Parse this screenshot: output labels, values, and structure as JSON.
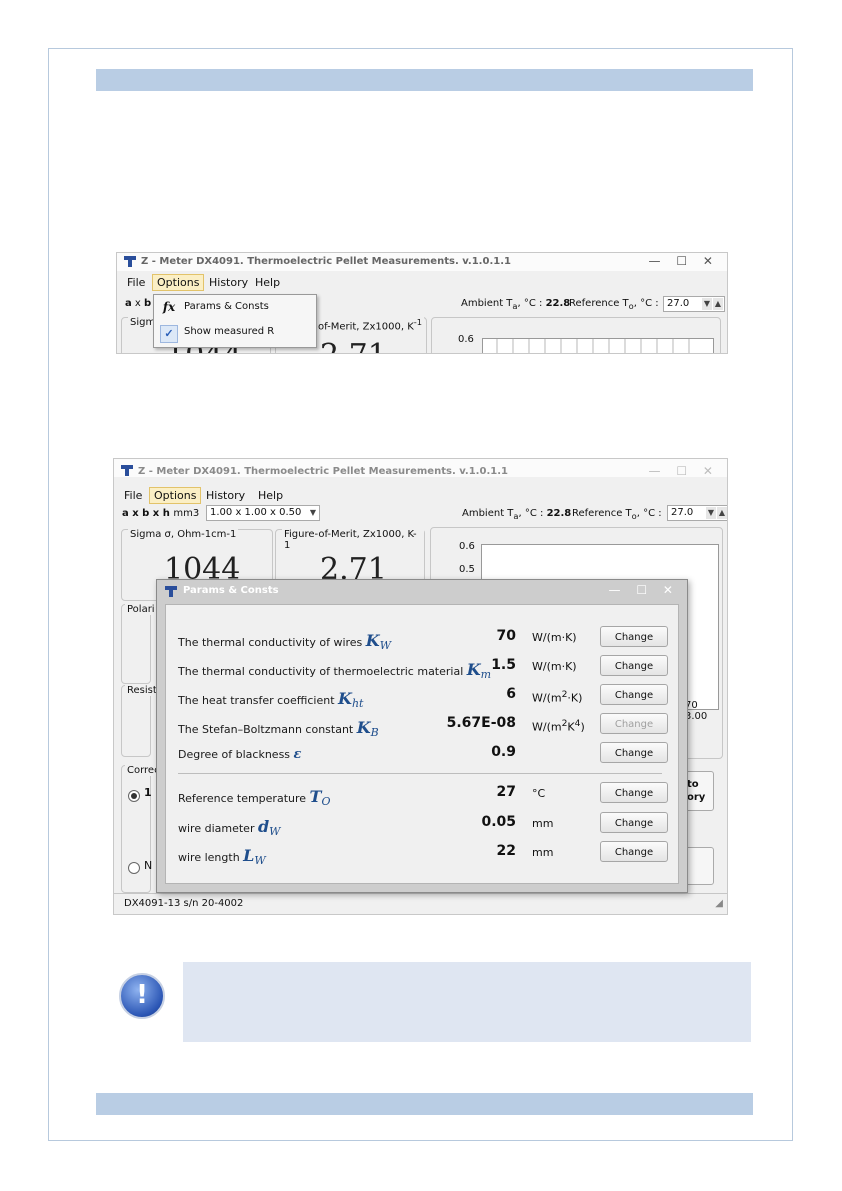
{
  "app": {
    "title": "Z - Meter DX4091. Thermoelectric Pellet Measurements. v.1.0.1.1",
    "window_controls": [
      "—",
      "☐",
      "✕"
    ],
    "menu": [
      "File",
      "Options",
      "History",
      "Help"
    ],
    "size_label": "a x b x h",
    "size_unit": "mm3",
    "size_value": "1.00 x 1.00 x 0.50",
    "ambient_label": "Ambient T",
    "ambient_sub": "a",
    "ambient_unit": ", °C :",
    "ambient_value": "22.8",
    "reference_label": "Reference T",
    "reference_sub": "o",
    "reference_unit": ", °C :",
    "reference_value": "27.0",
    "sigma_label": "Sigma σ, Ohm-1cm-1",
    "sigma_value": "1044",
    "zfom_label": "Figure-of-Merit, Zx1000, K-1",
    "zfom_value": "2.71",
    "chart_ticks": [
      "0.6",
      "0.5"
    ],
    "chart_xtick": "70 3.00",
    "group_labels": [
      "Polari",
      "Resist",
      "Correc"
    ],
    "radio_1": "1",
    "radio_n": "N",
    "side_button": "to ory",
    "status": "DX4091-13 s/n 20-4002"
  },
  "options_menu": {
    "items": [
      {
        "icon": "fx",
        "label": "Params & Consts"
      },
      {
        "icon": "✓",
        "label": "Show measured R"
      }
    ]
  },
  "dialog": {
    "title": "Params & Consts",
    "rows": [
      {
        "label": "The thermal conductivity of wires",
        "sym": "K",
        "sub": "W",
        "value": "70",
        "unit": "W/(m·K)",
        "button": "Change",
        "enabled": true
      },
      {
        "label": "The thermal conductivity of thermoelectric material",
        "sym": "K",
        "sub": "m",
        "value": "1.5",
        "unit": "W/(m·K)",
        "button": "Change",
        "enabled": true
      },
      {
        "label": "The heat transfer coefficient",
        "sym": "K",
        "sub": "ht",
        "value": "6",
        "unit": "W/(m2·K)",
        "button": "Change",
        "enabled": true
      },
      {
        "label": "The Stefan–Boltzmann constant",
        "sym": "K",
        "sub": "B",
        "value": "5.67E-08",
        "unit": "W/(m2K4)",
        "button": "Change",
        "enabled": false
      },
      {
        "label": "Degree of blackness",
        "sym": "ε",
        "sub": "",
        "value": "0.9",
        "unit": "",
        "button": "Change",
        "enabled": true
      },
      {
        "label": "Reference temperature",
        "sym": "T",
        "sub": "O",
        "value": "27",
        "unit": "°C",
        "button": "Change",
        "enabled": true
      },
      {
        "label": "wire diameter",
        "sym": "d",
        "sub": "W",
        "value": "0.05",
        "unit": "mm",
        "button": "Change",
        "enabled": true
      },
      {
        "label": "wire length",
        "sym": "L",
        "sub": "W",
        "value": "22",
        "unit": "mm",
        "button": "Change",
        "enabled": true
      }
    ]
  },
  "info_icon": "exclamation-icon",
  "colors": {
    "band": "#b9cde4",
    "menu_active": "#fbefc5",
    "symbol": "#1f4e8c",
    "info_box": "#dfe6f2"
  }
}
